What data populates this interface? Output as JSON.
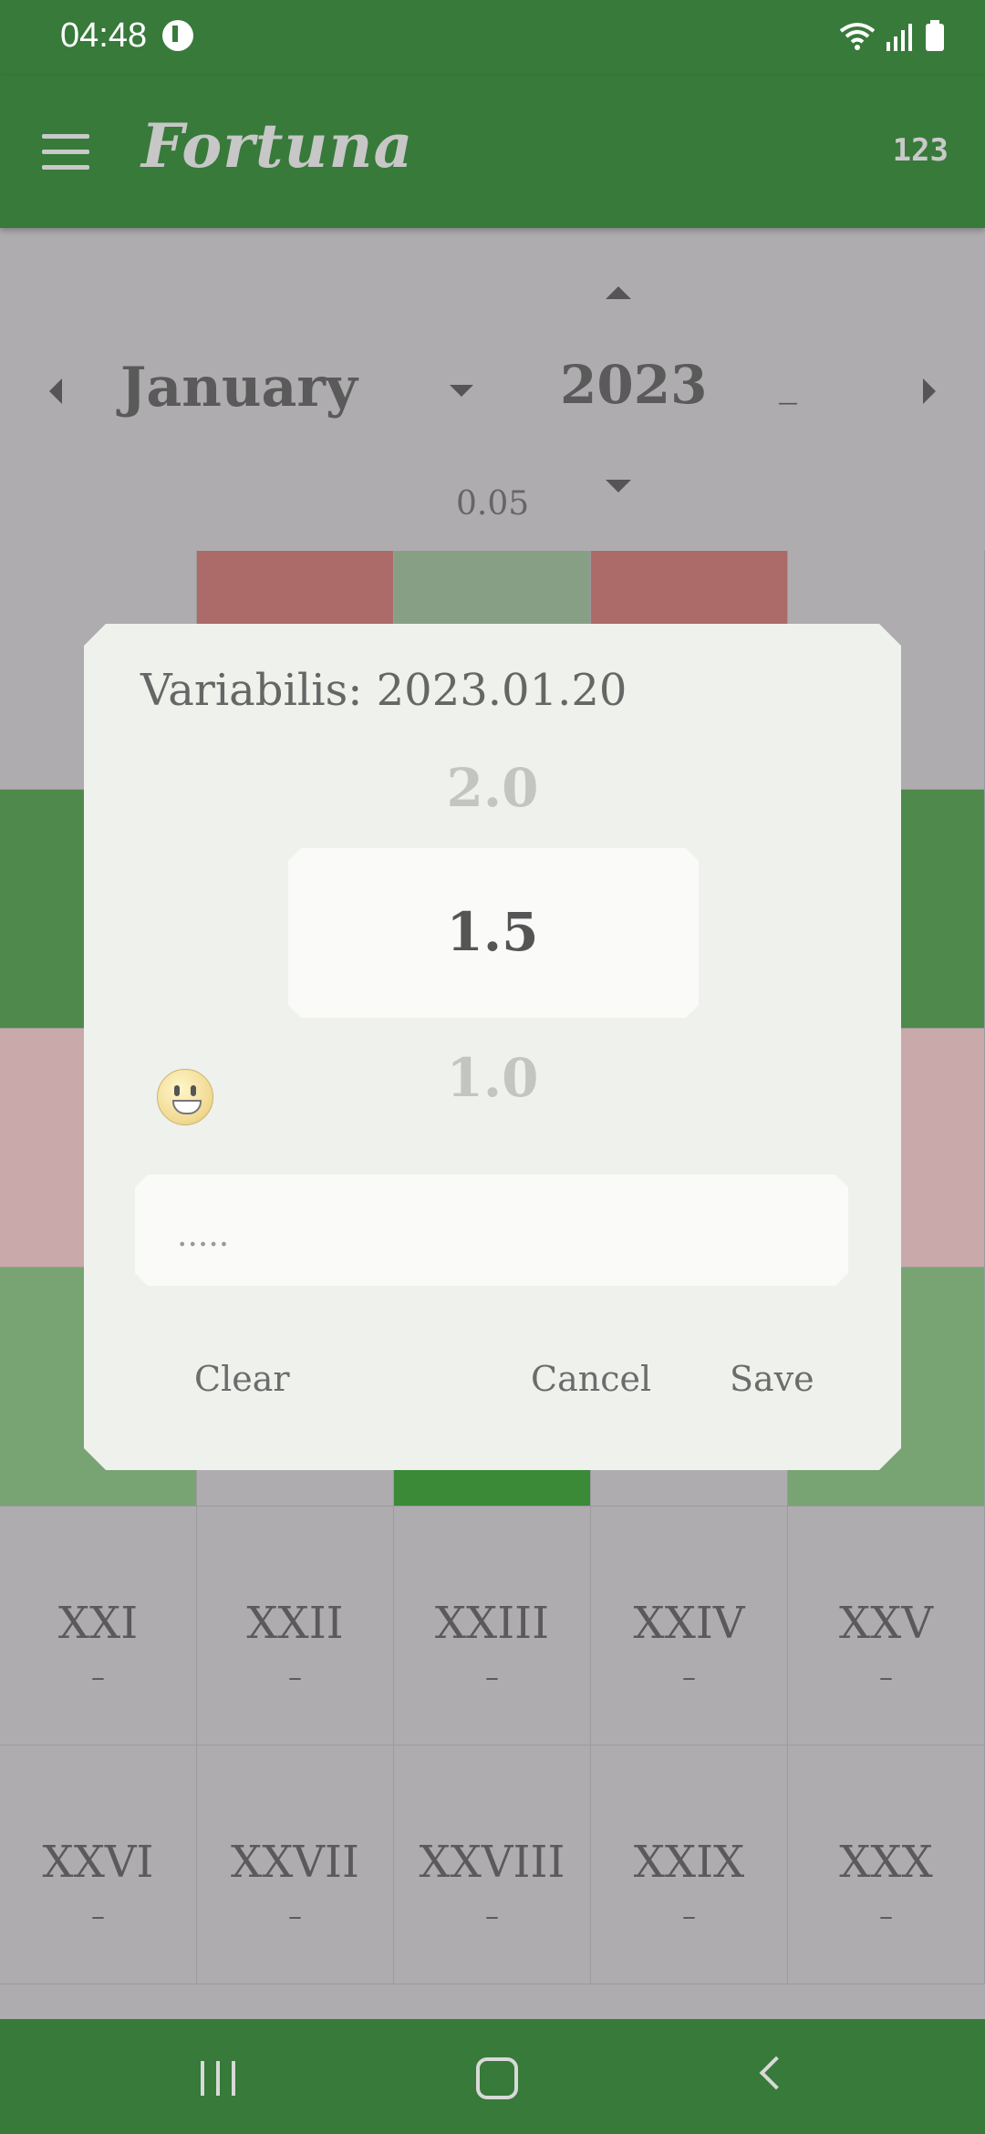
{
  "status": {
    "time": "04:48"
  },
  "app": {
    "title": "Fortuna",
    "numbers_label": "123"
  },
  "nav": {
    "month": "January",
    "year": "2023",
    "dash": "_",
    "step": "0.05"
  },
  "colors": {
    "primary": "#377a3a",
    "red": "#ac6b69",
    "soft_green": "#87a085",
    "mid_green": "#4f8a4c",
    "pink": "#c9a9aa",
    "light_green": "#78a474",
    "bright_green": "#3a8a38",
    "cell_gray": "#aeacaf"
  },
  "grid": {
    "rows": [
      [
        {
          "num": "",
          "val": "",
          "color": "#aeacaf"
        },
        {
          "num": "",
          "val": "",
          "color": "#ac6b69"
        },
        {
          "num": "",
          "val": "",
          "color": "#87a085"
        },
        {
          "num": "",
          "val": "",
          "color": "#ac6b69"
        },
        {
          "num": "",
          "val": "",
          "color": "#aeacaf"
        }
      ],
      [
        {
          "num": "",
          "val": "",
          "color": "#4f8a4c"
        },
        {
          "num": "",
          "val": "",
          "color": "#4f8a4c"
        },
        {
          "num": "",
          "val": "",
          "color": "#4f8a4c"
        },
        {
          "num": "",
          "val": "",
          "color": "#4f8a4c"
        },
        {
          "num": "",
          "val": "",
          "color": "#4f8a4c"
        }
      ],
      [
        {
          "num": "",
          "val": "",
          "color": "#c9a9aa"
        },
        {
          "num": "",
          "val": "",
          "color": "#c9a9aa"
        },
        {
          "num": "",
          "val": "",
          "color": "#c9a9aa"
        },
        {
          "num": "",
          "val": "",
          "color": "#c9a9aa"
        },
        {
          "num": "",
          "val": "",
          "color": "#c9a9aa"
        }
      ],
      [
        {
          "num": "",
          "val": "",
          "color": "#78a474"
        },
        {
          "num": "",
          "val": "",
          "color": "#aeacaf"
        },
        {
          "num": "",
          "val": "",
          "color": "#3a8a38"
        },
        {
          "num": "",
          "val": "",
          "color": "#aeacaf"
        },
        {
          "num": "",
          "val": "",
          "color": "#78a474"
        }
      ],
      [
        {
          "num": "XXI",
          "val": "–",
          "color": "#aeacaf"
        },
        {
          "num": "XXII",
          "val": "–",
          "color": "#aeacaf"
        },
        {
          "num": "XXIII",
          "val": "–",
          "color": "#aeacaf"
        },
        {
          "num": "XXIV",
          "val": "–",
          "color": "#aeacaf"
        },
        {
          "num": "XXV",
          "val": "–",
          "color": "#aeacaf"
        }
      ],
      [
        {
          "num": "XXVI",
          "val": "–",
          "color": "#aeacaf"
        },
        {
          "num": "XXVII",
          "val": "–",
          "color": "#aeacaf"
        },
        {
          "num": "XXVIII",
          "val": "–",
          "color": "#aeacaf"
        },
        {
          "num": "XXIX",
          "val": "–",
          "color": "#aeacaf"
        },
        {
          "num": "XXX",
          "val": "–",
          "color": "#aeacaf"
        }
      ]
    ]
  },
  "dialog": {
    "title": "Variabilis: 2023.01.20",
    "picker_prev": "2.0",
    "picker_current": "1.5",
    "picker_next": "1.0",
    "note_placeholder": ".....",
    "clear": "Clear",
    "cancel": "Cancel",
    "save": "Save"
  }
}
